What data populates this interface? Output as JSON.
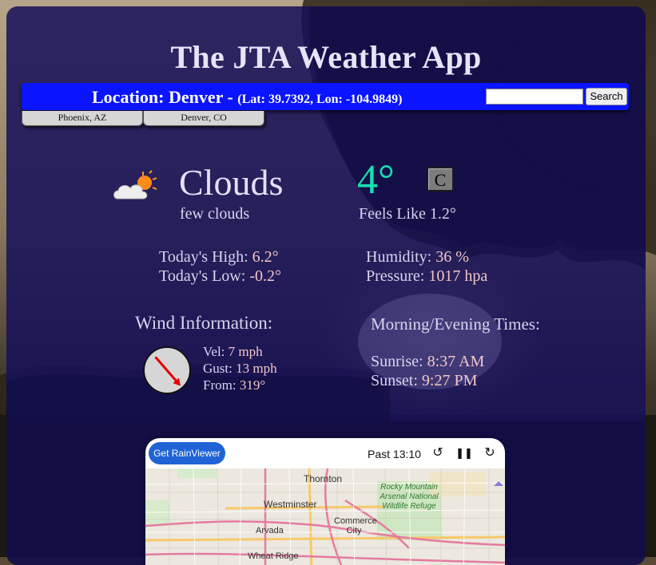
{
  "app": {
    "title": "The JTA Weather App"
  },
  "location": {
    "label": "Location: Denver - ",
    "coords": "(Lat: 39.7392, Lon: -104.9849)"
  },
  "search": {
    "value": "",
    "placeholder": "",
    "button_label": "Search"
  },
  "saved_locations": [
    "Phoenix, AZ",
    "Denver, CO"
  ],
  "current": {
    "condition": "Clouds",
    "description": "few clouds",
    "temperature": "4°",
    "unit_toggle": "C",
    "feels_like": "Feels Like 1.2°"
  },
  "stats": {
    "high_label": "Today's High: ",
    "high_value": "6.2°",
    "low_label": "Today's Low: ",
    "low_value": "-0.2°",
    "humidity_label": "Humidity: ",
    "humidity_value": "36 %",
    "pressure_label": "Pressure: ",
    "pressure_value": "1017 hpa"
  },
  "wind": {
    "heading": "Wind Information:",
    "vel_label": "Vel: ",
    "vel_value": "7 mph",
    "gust_label": "Gust: ",
    "gust_value": "13 mph",
    "from_label": "From: ",
    "from_value": "319°",
    "direction_deg": 319
  },
  "times": {
    "heading": "Morning/Evening Times:",
    "sunrise_label": "Sunrise: ",
    "sunrise_value": "8:37 AM",
    "sunset_label": "Sunset: ",
    "sunset_value": "9:27 PM"
  },
  "radar": {
    "button_label": "Get RainViewer",
    "time_label": "Past 13:10",
    "map_labels": {
      "thornton": "Thornton",
      "westminster": "Westminster",
      "arvada": "Arvada",
      "commerce_city": "Commerce City",
      "wheat_ridge": "Wheat Ridge",
      "rocky_mountain": "Rocky Mountain Arsenal National Wildlife Refuge"
    }
  },
  "colors": {
    "location_bar": "#0a14ff",
    "temperature": "#19e0b0",
    "value_text": "#f3c6c6",
    "panel": "#16105a"
  }
}
